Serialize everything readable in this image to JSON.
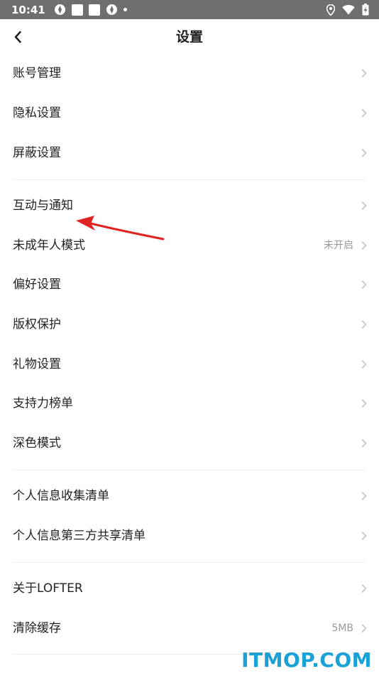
{
  "status_bar": {
    "time": "10:41"
  },
  "header": {
    "title": "设置"
  },
  "settings": {
    "account": "账号管理",
    "privacy": "隐私设置",
    "block": "屏蔽设置",
    "notifications": "互动与通知",
    "minor_mode": "未成年人模式",
    "minor_mode_value": "未开启",
    "preferences": "偏好设置",
    "copyright": "版权保护",
    "gifts": "礼物设置",
    "support_ranking": "支持力榜单",
    "dark_mode": "深色模式",
    "personal_info_list": "个人信息收集清单",
    "third_party_list": "个人信息第三方共享清单",
    "about": "关于LOFTER",
    "clear_cache": "清除缓存",
    "clear_cache_value": "5MB"
  },
  "watermark": {
    "text": "ITMOP.COM"
  },
  "colors": {
    "status_bar": "#6f6f6f",
    "annotation_arrow": "#e02424",
    "watermark": "#1aa1d8"
  }
}
